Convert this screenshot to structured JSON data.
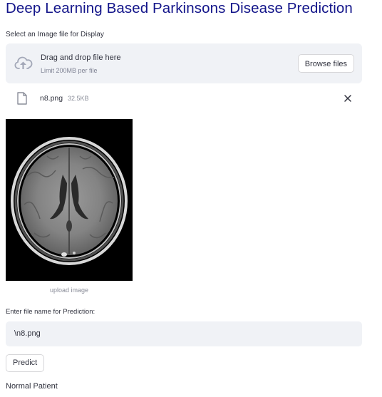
{
  "app": {
    "title": "Deep Learning Based Parkinsons Disease Prediction"
  },
  "uploader": {
    "label": "Select an Image file for Display",
    "drop_text": "Drag and drop file here",
    "limit_text": "Limit 200MB per file",
    "browse_label": "Browse files",
    "icon": "cloud-upload-icon"
  },
  "uploaded_file": {
    "name": "n8.png",
    "size": "32.5KB",
    "icon": "file-icon",
    "remove_icon": "close-icon"
  },
  "image": {
    "caption": "upload image"
  },
  "prediction_input": {
    "label": "Enter file name for Prediction:",
    "value": "\\n8.png"
  },
  "predict_button": {
    "label": "Predict"
  },
  "result": {
    "text": "Normal Patient"
  },
  "colors": {
    "title": "#13158a",
    "widget_bg": "#f0f2f6",
    "text": "#31333f",
    "muted": "#808495"
  }
}
